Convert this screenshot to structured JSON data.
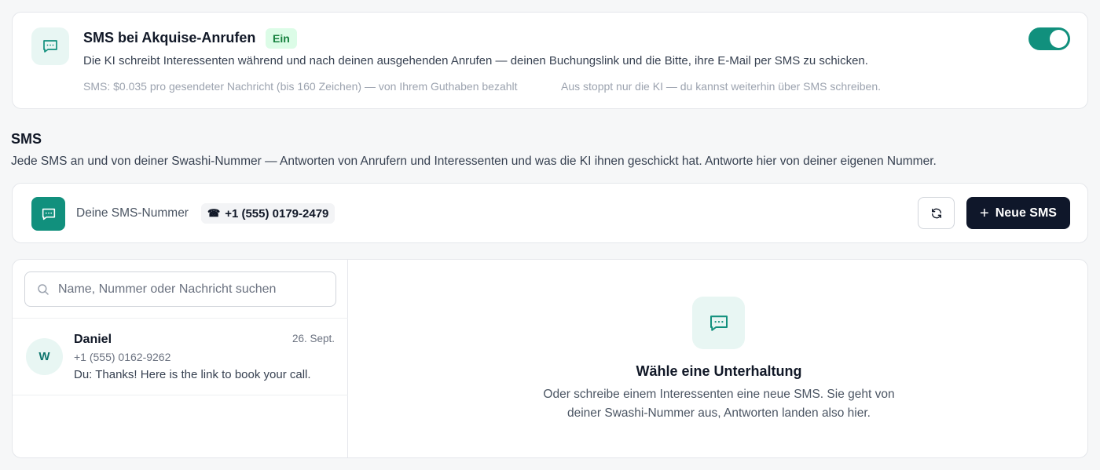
{
  "auto_sms": {
    "title": "SMS bei Akquise-Anrufen",
    "status_badge": "Ein",
    "description": "Die KI schreibt Interessenten während und nach deinen ausgehenden Anrufen — deinen Buchungslink und die Bitte, ihre E-Mail per SMS zu schicken.",
    "cost_note": "SMS: $0.035 pro gesendeter Nachricht (bis 160 Zeichen) — von Ihrem Guthaben bezahlt",
    "off_note": "Aus stoppt nur die KI — du kannst weiterhin über SMS schreiben.",
    "enabled": true,
    "icon": "chat-bubble-icon"
  },
  "section": {
    "title": "SMS",
    "description": "Jede SMS an und von deiner Swashi-Nummer — Antworten von Anrufern und Interessenten und was die KI ihnen geschickt hat. Antworte hier von deiner eigenen Nummer."
  },
  "number_bar": {
    "label": "Deine SMS-Nummer",
    "phone_glyph": "☎",
    "number": "+1 (555) 0179-2479",
    "refresh_icon": "refresh-icon",
    "new_button_icon": "+",
    "new_button_label": "Neue SMS"
  },
  "inbox": {
    "search_placeholder": "Name, Nummer oder Nachricht suchen",
    "search_value": "",
    "conversations": [
      {
        "initial": "W",
        "name": "Daniel",
        "date": "26. Sept.",
        "phone": "+1 (555) 0162-9262",
        "preview": "Du: Thanks! Here is the link to book your call."
      }
    ],
    "empty_state": {
      "title": "Wähle eine Unterhaltung",
      "description": "Oder schreibe einem Interessenten eine neue SMS. Sie geht von deiner Swashi-Nummer aus, Antworten landen also hier."
    }
  },
  "colors": {
    "accent": "#11907d",
    "accent_light": "#e8f6f3",
    "badge_bg": "#dcfce7",
    "badge_text": "#15803d",
    "primary_button": "#0f172a"
  }
}
